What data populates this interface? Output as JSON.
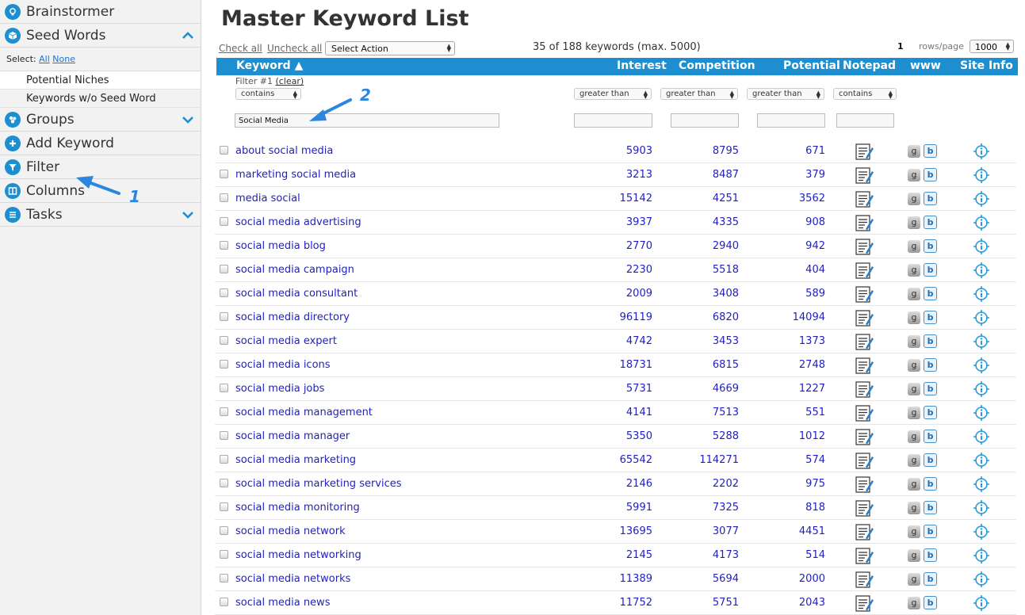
{
  "sidebar": {
    "brainstormer": "Brainstormer",
    "seed_words": "Seed Words",
    "select_label": "Select:",
    "select_all": "All",
    "select_none": "None",
    "sub_items": [
      "Potential Niches",
      "Keywords w/o Seed Word"
    ],
    "groups": "Groups",
    "add_keyword": "Add Keyword",
    "filter": "Filter",
    "columns": "Columns",
    "tasks": "Tasks"
  },
  "main": {
    "title": "Master Keyword List",
    "check_all": "Check all",
    "uncheck_all": "Uncheck all",
    "select_action": "Select Action",
    "keyword_count": "35 of 188 keywords (max. 5000)",
    "page": "1",
    "rows_per_page_label": "rows/page",
    "rows_per_page": "1000"
  },
  "columns": {
    "keyword": "Keyword ▲",
    "interest": "Interest",
    "competition": "Competition",
    "potential": "Potential",
    "notepad": "Notepad",
    "www": "www",
    "site_info": "Site Info"
  },
  "filter": {
    "label": "Filter #1",
    "clear": "(clear)",
    "keyword_op": "contains",
    "keyword_value": "Social Media",
    "interest_op": "greater than",
    "competition_op": "greater than",
    "potential_op": "greater than",
    "notepad_op": "contains"
  },
  "annotations": {
    "one": "1",
    "two": "2"
  },
  "colors": {
    "accent": "#1d8fd1",
    "link": "#1f1fbf"
  },
  "rows": [
    {
      "keyword": "about social media",
      "interest": "5903",
      "competition": "8795",
      "potential": "671"
    },
    {
      "keyword": "marketing social media",
      "interest": "3213",
      "competition": "8487",
      "potential": "379"
    },
    {
      "keyword": "media social",
      "interest": "15142",
      "competition": "4251",
      "potential": "3562"
    },
    {
      "keyword": "social media advertising",
      "interest": "3937",
      "competition": "4335",
      "potential": "908"
    },
    {
      "keyword": "social media blog",
      "interest": "2770",
      "competition": "2940",
      "potential": "942"
    },
    {
      "keyword": "social media campaign",
      "interest": "2230",
      "competition": "5518",
      "potential": "404"
    },
    {
      "keyword": "social media consultant",
      "interest": "2009",
      "competition": "3408",
      "potential": "589"
    },
    {
      "keyword": "social media directory",
      "interest": "96119",
      "competition": "6820",
      "potential": "14094"
    },
    {
      "keyword": "social media expert",
      "interest": "4742",
      "competition": "3453",
      "potential": "1373"
    },
    {
      "keyword": "social media icons",
      "interest": "18731",
      "competition": "6815",
      "potential": "2748"
    },
    {
      "keyword": "social media jobs",
      "interest": "5731",
      "competition": "4669",
      "potential": "1227"
    },
    {
      "keyword": "social media management",
      "interest": "4141",
      "competition": "7513",
      "potential": "551"
    },
    {
      "keyword": "social media manager",
      "interest": "5350",
      "competition": "5288",
      "potential": "1012"
    },
    {
      "keyword": "social media marketing",
      "interest": "65542",
      "competition": "114271",
      "potential": "574"
    },
    {
      "keyword": "social media marketing services",
      "interest": "2146",
      "competition": "2202",
      "potential": "975"
    },
    {
      "keyword": "social media monitoring",
      "interest": "5991",
      "competition": "7325",
      "potential": "818"
    },
    {
      "keyword": "social media network",
      "interest": "13695",
      "competition": "3077",
      "potential": "4451"
    },
    {
      "keyword": "social media networking",
      "interest": "2145",
      "competition": "4173",
      "potential": "514"
    },
    {
      "keyword": "social media networks",
      "interest": "11389",
      "competition": "5694",
      "potential": "2000"
    },
    {
      "keyword": "social media news",
      "interest": "11752",
      "competition": "5751",
      "potential": "2043"
    }
  ]
}
